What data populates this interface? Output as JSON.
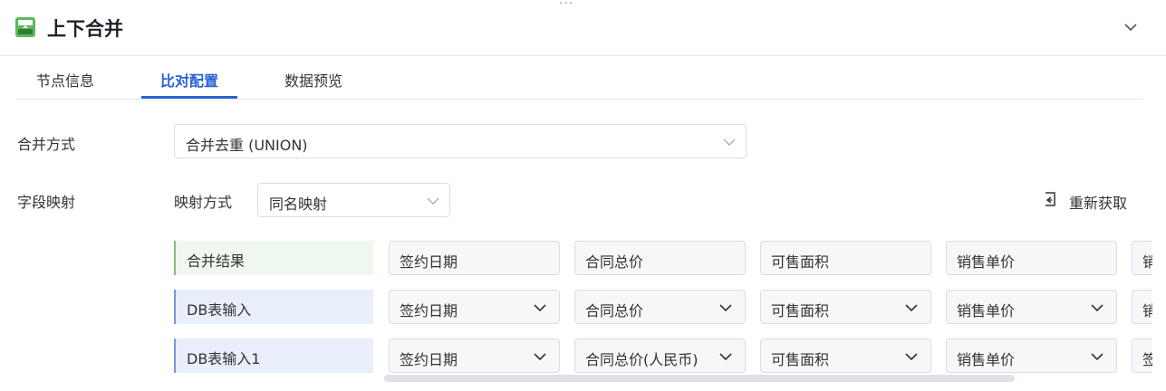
{
  "window": {
    "drag_handle": "···",
    "title": "上下合并"
  },
  "tabs": [
    {
      "label": "节点信息"
    },
    {
      "label": "比对配置"
    },
    {
      "label": "数据预览"
    }
  ],
  "merge": {
    "label": "合并方式",
    "value": "合并去重 (UNION)"
  },
  "mapping": {
    "label": "字段映射",
    "mode_label": "映射方式",
    "mode_value": "同名映射",
    "refresh_label": "重新获取"
  },
  "rows": [
    {
      "name": "合并结果",
      "cells": [
        "签约日期",
        "合同总价",
        "可售面积",
        "销售单价",
        "销"
      ]
    },
    {
      "name": "DB表输入",
      "cells": [
        "签约日期",
        "合同总价",
        "可售面积",
        "销售单价",
        "销"
      ]
    },
    {
      "name": "DB表输入1",
      "cells": [
        "签约日期",
        "合同总价(人民币)",
        "可售面积",
        "销售单价",
        "签"
      ]
    }
  ],
  "colors": {
    "accent": "#2961d6",
    "result_bg": "#eef8ee",
    "input_bg": "#e9eefb"
  },
  "icons": [
    "merge-node-icon",
    "chevron-down-icon",
    "refresh-icon"
  ]
}
